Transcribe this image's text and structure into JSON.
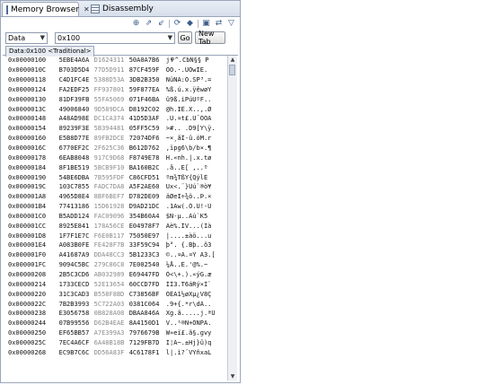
{
  "tabs": {
    "memory_browser": "Memory Browser",
    "disassembly": "Disassembly",
    "close_glyph": "✕"
  },
  "toolbar_icons": [
    "pin-icon",
    "export-icon",
    "import-icon",
    "refresh-icon",
    "clear-icon",
    "new-view-icon",
    "link-icon",
    "view-menu-icon"
  ],
  "address_bar": {
    "context_value": "Data",
    "address_value": "0x100",
    "go_label": "Go",
    "new_tab_label": "New Tab"
  },
  "rendering_tab": "Data:0x100 <Traditional>",
  "rows": [
    {
      "addr": "0x00000100",
      "h1": "5EBE4A6A",
      "h2": "D1624311",
      "h3": "50A0A7B6",
      "txt": "j߾^.CbÑ§§ P"
    },
    {
      "addr": "0x0000010C",
      "h1": "B703D5D4",
      "h2": "77D5D911",
      "h3": "87CF459F",
      "txt": "ÔÕ.·.ÙÕwÏE."
    },
    {
      "addr": "0x00000118",
      "h1": "C4D1FC4E",
      "h2": "5388D53A",
      "h3": "3DB2B350",
      "txt": "NüÑÄ:Õ.SP³.="
    },
    {
      "addr": "0x00000124",
      "h1": "FA2EDF25",
      "h2": "FF937801",
      "h3": "59F877EA",
      "txt": "%ß.ú.x.ÿêwøY"
    },
    {
      "addr": "0x00000130",
      "h1": "81DF39FB",
      "h2": "55FA5069",
      "h3": "071F46BA",
      "txt": "û9ß.iPúUºF.."
    },
    {
      "addr": "0x0000013C",
      "h1": "49006840",
      "h2": "9D589DCA",
      "h3": "D8192C02",
      "txt": "@h.IÊ.X..,.Ø"
    },
    {
      "addr": "0x00000148",
      "h1": "A48AD98E",
      "h2": "DC1CA374",
      "h3": "41D5D3AF",
      "txt": ".Ù.¤t£.Ü¯ÓÕA"
    },
    {
      "addr": "0x00000154",
      "h1": "89239F3E",
      "h2": "5B394481",
      "h3": "05FF5C59",
      "txt": ">#.. .D9[Y\\ÿ."
    },
    {
      "addr": "0x00000160",
      "h1": "E5B8D77E",
      "h2": "89FB2DCE",
      "h3": "72074DF6",
      "txt": "~×¸åÎ-û.öM.r"
    },
    {
      "addr": "0x0000016C",
      "h1": "6770EF2C",
      "h2": "2F625C36",
      "h3": "B612D762",
      "txt": ",ïpg6\\b/b×.¶"
    },
    {
      "addr": "0x00000178",
      "h1": "6EAB8048",
      "h2": "917C9D68",
      "h3": "F8749E78",
      "txt": "H.«nh.|.x.tø"
    },
    {
      "addr": "0x00000184",
      "h1": "8F1BE519",
      "h2": "5BCB9F10",
      "h3": "BA160B2C",
      "txt": ".å..Ë[ ,..º"
    },
    {
      "addr": "0x00000190",
      "h1": "54BE6DBA",
      "h2": "7B595FDF",
      "h3": "C86CFD51",
      "txt": "ºm¾TßY{QýlÈ"
    },
    {
      "addr": "0x0000019C",
      "h1": "103C7855",
      "h2": "FADC7DA8",
      "h3": "A5F2AE60",
      "txt": "Ux<.¨}Üú`®ò¥"
    },
    {
      "addr": "0x000001A8",
      "h1": "4965D8E4",
      "h2": "8BF6BEF7",
      "h3": "D782DE09",
      "txt": "äØeI÷¾ö..Þ.×"
    },
    {
      "addr": "0x000001B4",
      "h1": "77413186",
      "h2": "15D61928",
      "h3": "D9AD21DC",
      "txt": ".1Aw(.Ö.Ü!-Ù"
    },
    {
      "addr": "0x000001C0",
      "h1": "B5ADD124",
      "h2": "FAC09096",
      "h3": "354B60A4",
      "txt": "$Ñ-µ..Àú`K5"
    },
    {
      "addr": "0x000001CC",
      "h1": "8925E841",
      "h2": "178A56CE",
      "h3": "E04978F7",
      "txt": "Aè%.ÎV...(Ià"
    },
    {
      "addr": "0x000001D8",
      "h1": "1F7F1E7C",
      "h2": "F6E0B117",
      "h3": "75050E97",
      "txt": "|....±àö...u"
    },
    {
      "addr": "0x000001E4",
      "h1": "A083B0FE",
      "h2": "FE428F7B",
      "h3": "33F59C94",
      "txt": "þ°. {.Bþ..õ3"
    },
    {
      "addr": "0x000001F0",
      "h1": "A41687A9",
      "h2": "DDA48CC3",
      "h3": "5B1233C3",
      "txt": "©..¤Ã.¤Ý Ã3.["
    },
    {
      "addr": "0x000001FC",
      "h1": "9094C5BC",
      "h2": "279C86C8",
      "h3": "7E002540",
      "txt": "¼Å..È.'@%.~"
    },
    {
      "addr": "0x00000208",
      "h1": "2B5C3CD6",
      "h2": "AB032989",
      "h3": "E69447FD",
      "txt": "Ö<\\+.).«ýG.æ"
    },
    {
      "addr": "0x00000214",
      "h1": "1733CECD",
      "h2": "52E13654",
      "h3": "60CCD7FD",
      "txt": "ÍÎ3.T6áRý×Ì`"
    },
    {
      "addr": "0x00000220",
      "h1": "31C3CAD3",
      "h2": "B558F8BD",
      "h3": "C73856BF",
      "txt": "ÓÊÃ1½øXµ¿V8Ç"
    },
    {
      "addr": "0x0000022C",
      "h1": "7B2B3993",
      "h2": "5C722A03",
      "h3": "0381C064",
      "txt": ".9+{.*r\\dÀ.."
    },
    {
      "addr": "0x00000238",
      "h1": "E3056758",
      "h2": "0B828A08",
      "h3": "DBAA846A",
      "txt": "Xg.ã.....j.ªÛ"
    },
    {
      "addr": "0x00000244",
      "h1": "07B99556",
      "h2": "D62B4EAE",
      "h3": "8A4150D1",
      "txt": "V..¹®N+ÖÑPA."
    },
    {
      "addr": "0x00000250",
      "h1": "EF65BB57",
      "h2": "A7E399A3",
      "h3": "7976679B",
      "txt": "W»eï£.ã§.gvy"
    },
    {
      "addr": "0x0000025C",
      "h1": "7EC4A6CF",
      "h2": "6A48B18B",
      "h3": "7129FB7D",
      "txt": "Ï¦Ä~.±Hj}û)q"
    },
    {
      "addr": "0x00000268",
      "h1": "EC9B7C6C",
      "h2": "DD56A83F",
      "h3": "4C6178F1",
      "txt": "l|.ì?¨VÝñxaL"
    }
  ]
}
